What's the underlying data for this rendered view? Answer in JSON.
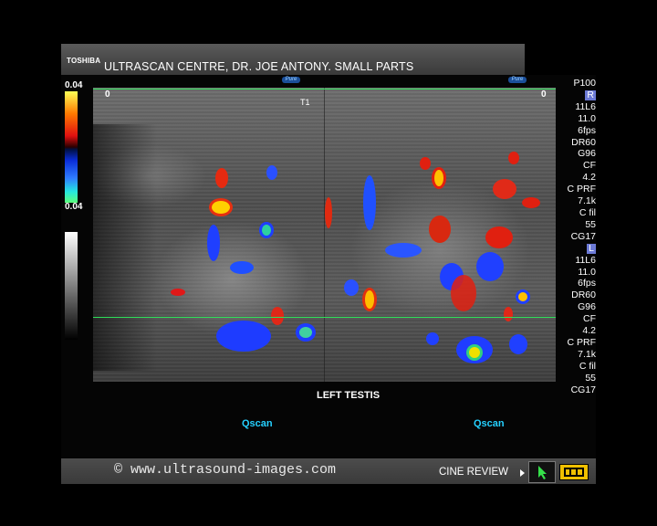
{
  "header": {
    "brand": "TOSHIBA",
    "title": "ULTRASCAN CENTRE, DR. JOE ANTONY.  SMALL PARTS",
    "pure_badge": "Pure"
  },
  "colorscale": {
    "top_value": "0.04",
    "bottom_value": "0.04"
  },
  "image": {
    "depth_left": "0",
    "depth_right": "0",
    "marker": "T1",
    "caption": "LEFT TESTIS",
    "qscan_left": "Qscan",
    "qscan_right": "Qscan"
  },
  "params_upper": {
    "power": "P100",
    "side": "R",
    "probe": "11L6",
    "freq": "11.0",
    "fps": "6fps",
    "dr": "DR60",
    "gain": "G96",
    "cf_label": "CF",
    "cf_value": "4.2",
    "prf_label": "C PRF",
    "prf_value": "7.1k",
    "fil_label": "C fil",
    "fil_value": "55"
  },
  "params_lower": {
    "cg": "CG17",
    "side": "L",
    "probe": "11L6",
    "freq": "11.0",
    "fps": "6fps",
    "dr": "DR60",
    "gain": "G96",
    "cf_label": "CF",
    "cf_value": "4.2",
    "prf_label": "C PRF",
    "prf_value": "7.1k",
    "fil_label": "C fil",
    "fil_value": "55",
    "cg_bottom": "CG17"
  },
  "footer": {
    "copyright": "© www.ultrasound-images.com",
    "cine_review": "CINE REVIEW"
  },
  "colors": {
    "guide_line": "#2fe05a",
    "flow_red": "#e01010",
    "flow_blue": "#1a3cff",
    "film_button": "#f0c000"
  }
}
